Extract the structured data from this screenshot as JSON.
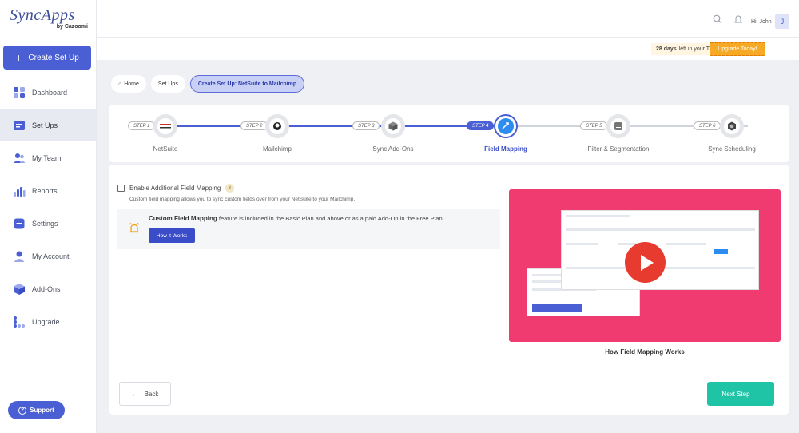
{
  "brand": {
    "name": "SyncApps",
    "sub": "by Cazoomi"
  },
  "sidebar": {
    "create_label": "Create Set Up",
    "items": [
      {
        "label": "Dashboard",
        "icon": "dashboard-icon"
      },
      {
        "label": "Set Ups",
        "icon": "setups-icon",
        "active": true
      },
      {
        "label": "My Team",
        "icon": "team-icon"
      },
      {
        "label": "Reports",
        "icon": "reports-icon"
      },
      {
        "label": "Settings",
        "icon": "settings-icon"
      },
      {
        "label": "My Account",
        "icon": "account-icon"
      },
      {
        "label": "Add-Ons",
        "icon": "addons-icon"
      },
      {
        "label": "Upgrade",
        "icon": "upgrade-icon"
      }
    ],
    "support_label": "Support"
  },
  "header": {
    "greeting": "Hi, John",
    "avatar_initial": "J"
  },
  "trial": {
    "days": "28 days",
    "text": "left in your Trial",
    "upgrade_label": "Upgrade Today!"
  },
  "breadcrumb": {
    "home": "Home",
    "setups": "Set Ups",
    "current": "Create Set Up: NetSuite to Mailchimp"
  },
  "steps": [
    {
      "badge": "STEP 1",
      "label": "NetSuite"
    },
    {
      "badge": "STEP 2",
      "label": "Mailchimp"
    },
    {
      "badge": "STEP 3",
      "label": "Sync Add-Ons"
    },
    {
      "badge": "STEP 4",
      "label": "Field Mapping",
      "active": true
    },
    {
      "badge": "STEP 5",
      "label": "Filter & Segmentation"
    },
    {
      "badge": "STEP 6",
      "label": "Sync Scheduling"
    }
  ],
  "mapping": {
    "enable_label": "Enable Additional Field Mapping",
    "description": "Custom field mapping allows you to sync custom fields over from your NetSuite to your Mailchimp.",
    "promo_title": "Custom Field Mapping",
    "promo_text": "feature is included in the Basic Plan and above or as a paid Add-On in the Free Plan.",
    "how_label": "How it Works",
    "video_caption": "How Field Mapping Works"
  },
  "footer": {
    "back_label": "Back",
    "next_label": "Next Step"
  },
  "colors": {
    "primary": "#4a5fd4",
    "accent": "#1fc4a6",
    "upgrade": "#f6a925",
    "video_bg": "#ef3b6f"
  }
}
